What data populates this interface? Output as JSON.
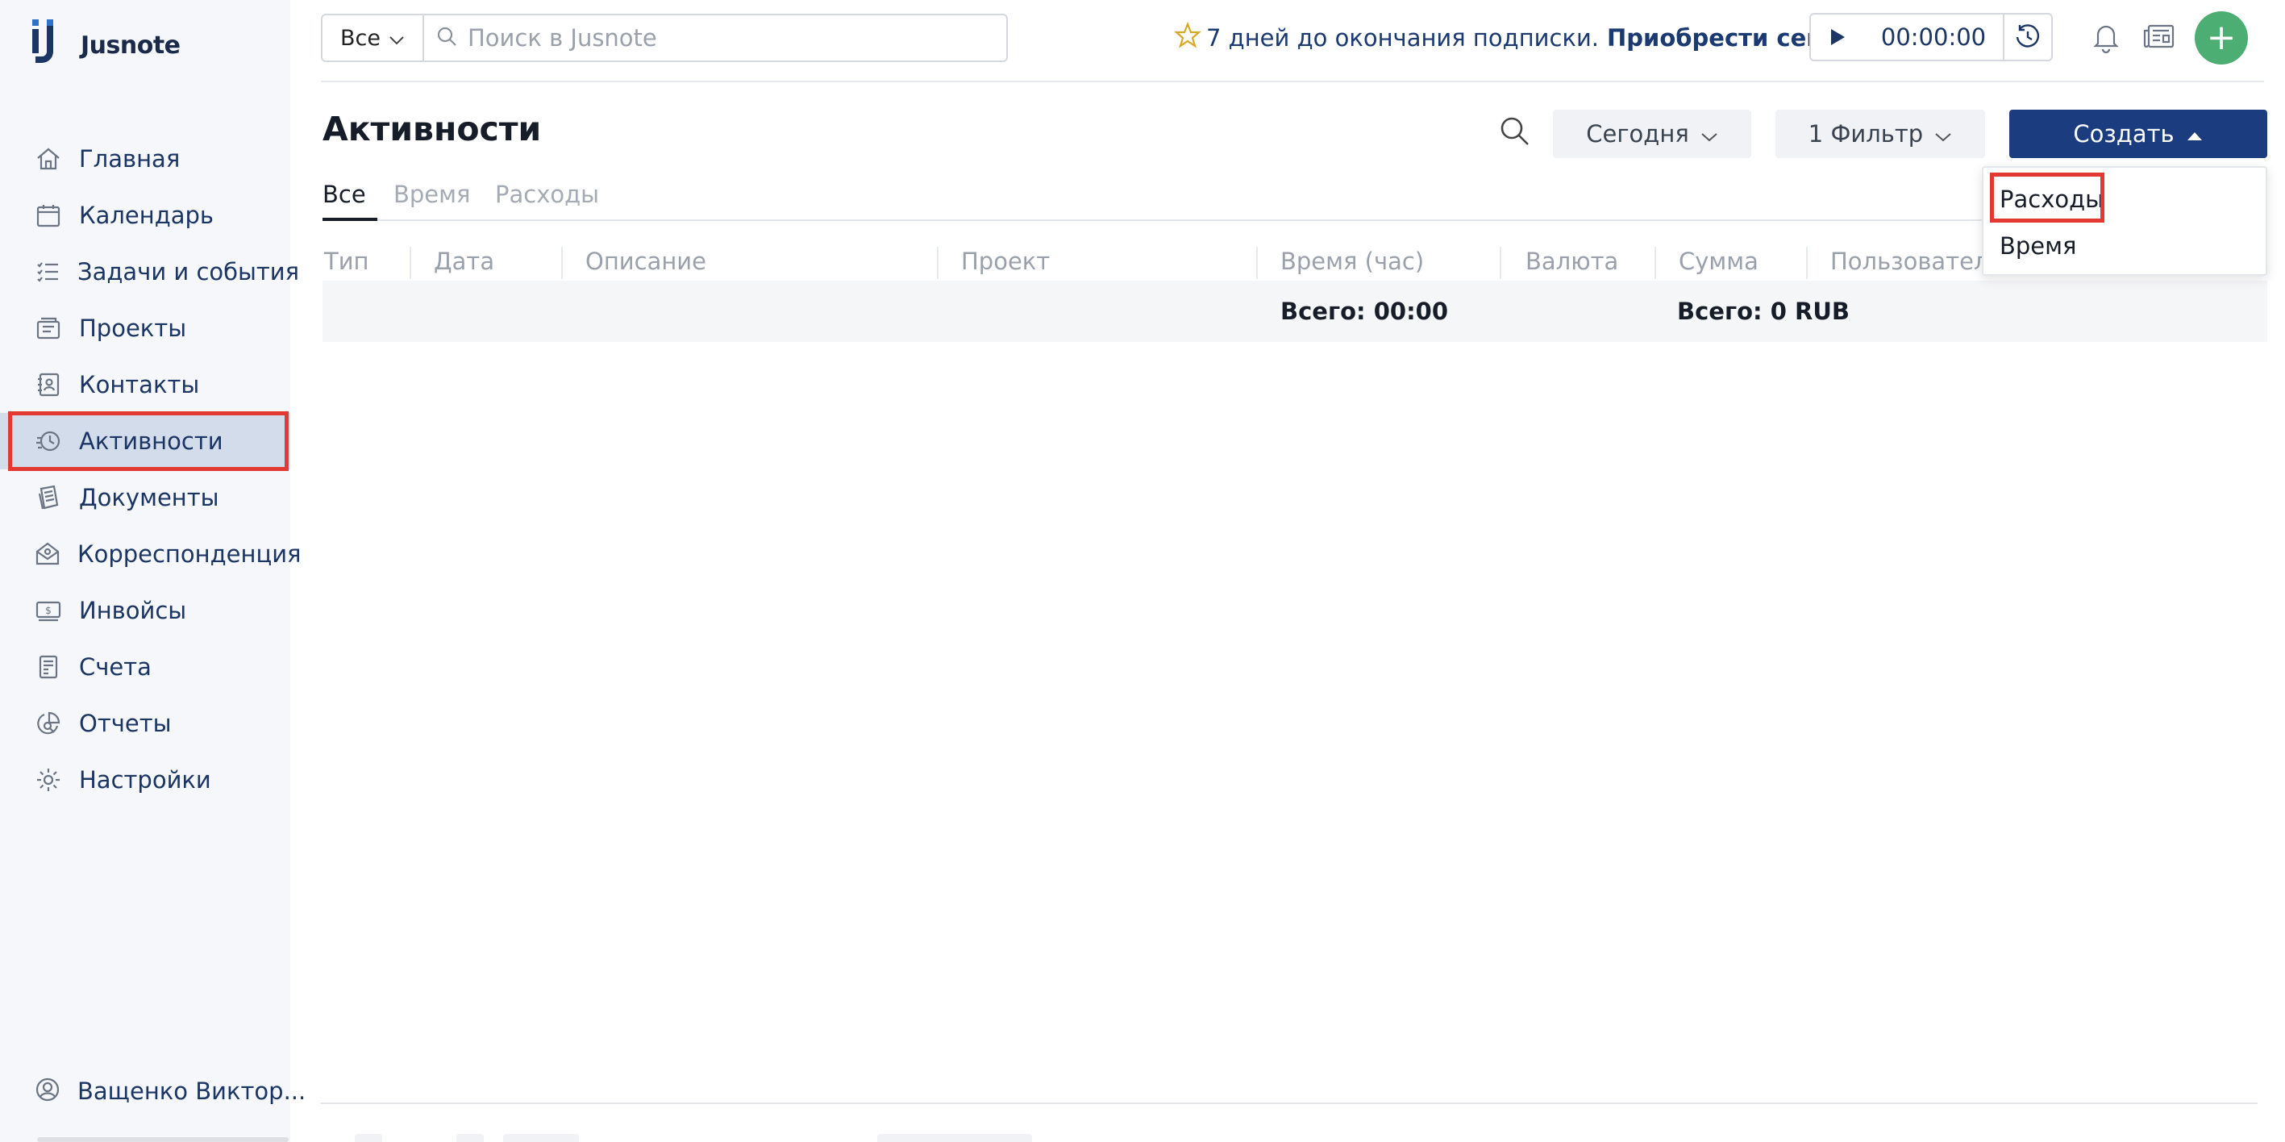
{
  "app": {
    "name": "Jusnote"
  },
  "sidebar": {
    "items": [
      {
        "key": "home",
        "label": "Главная",
        "icon": "home-icon"
      },
      {
        "key": "calendar",
        "label": "Календарь",
        "icon": "calendar-icon"
      },
      {
        "key": "tasks",
        "label": "Задачи и события",
        "icon": "tasks-icon"
      },
      {
        "key": "projects",
        "label": "Проекты",
        "icon": "projects-icon"
      },
      {
        "key": "contacts",
        "label": "Контакты",
        "icon": "contacts-icon"
      },
      {
        "key": "activities",
        "label": "Активности",
        "icon": "activity-icon",
        "active": true
      },
      {
        "key": "documents",
        "label": "Документы",
        "icon": "documents-icon"
      },
      {
        "key": "correspondence",
        "label": "Корреспонденция",
        "icon": "mail-icon"
      },
      {
        "key": "invoices",
        "label": "Инвойсы",
        "icon": "invoice-icon"
      },
      {
        "key": "accounts",
        "label": "Счета",
        "icon": "accounts-icon"
      },
      {
        "key": "reports",
        "label": "Отчеты",
        "icon": "reports-icon"
      },
      {
        "key": "settings",
        "label": "Настройки",
        "icon": "gear-icon"
      }
    ],
    "user": {
      "label": "Ващенко Виктор..."
    }
  },
  "topbar": {
    "scope": "Все",
    "search_placeholder": "Поиск в Jusnote",
    "promo_message": "7 дней до окончания подписки.",
    "promo_cta": "Приобрести сейчас",
    "timer": "00:00:00",
    "add_label": "+"
  },
  "main": {
    "title": "Активности",
    "filters": {
      "period": "Сегодня",
      "filter": "1 Фильтр"
    },
    "create_label": "Создать",
    "tabs": [
      {
        "label": "Все",
        "active": true
      },
      {
        "label": "Время",
        "active": false
      },
      {
        "label": "Расходы",
        "active": false
      }
    ],
    "columns": [
      "Тип",
      "Дата",
      "Описание",
      "Проект",
      "Время (час)",
      "Валюта",
      "Сумма",
      "Пользователь"
    ],
    "totals": {
      "time": "Всего: 00:00",
      "sum": "Всего: 0 RUB"
    },
    "create_menu": [
      "Расходы",
      "Время"
    ]
  },
  "colors": {
    "brand_navy": "#1b3c7e",
    "active_nav_bg": "#d3dcea",
    "add_green": "#4cae72",
    "highlight_red": "#e23a32"
  }
}
